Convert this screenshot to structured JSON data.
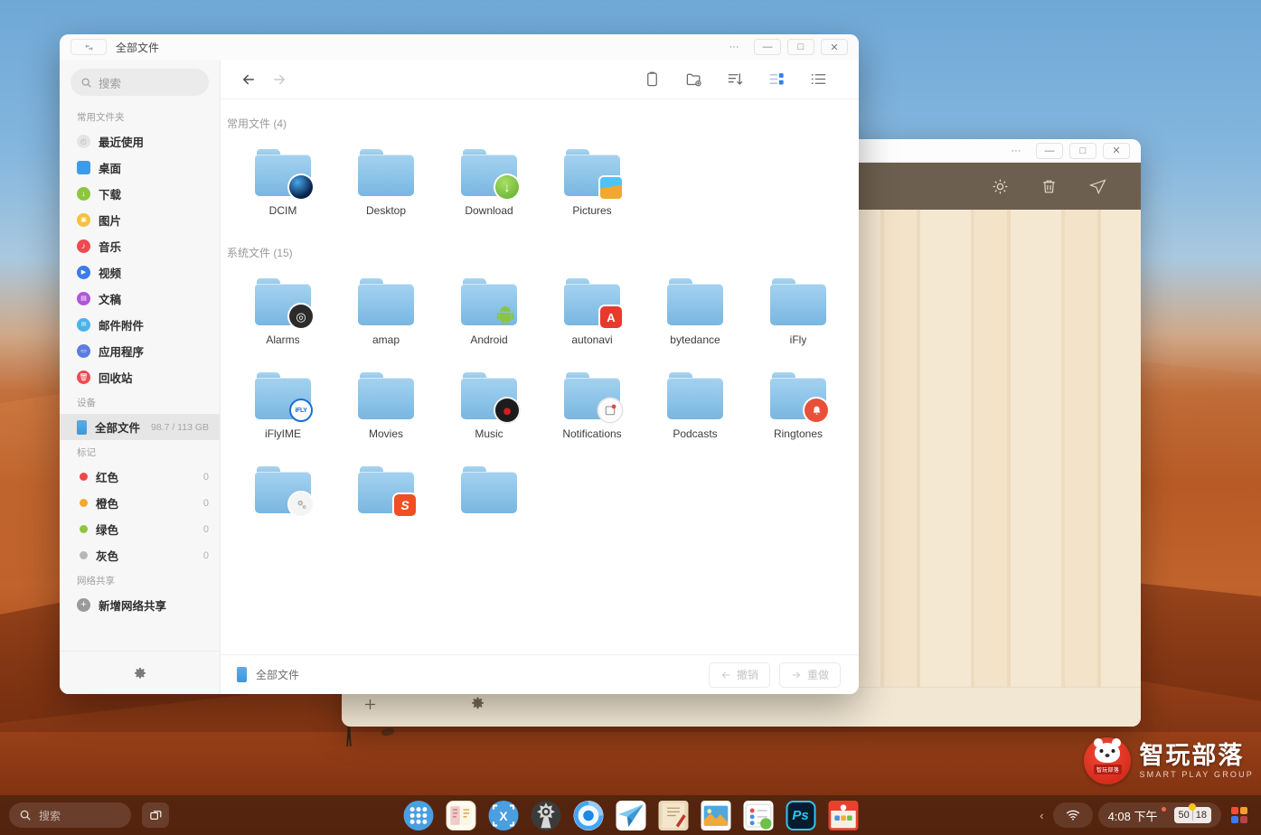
{
  "desktop": {
    "watermark": {
      "title": "智玩部落",
      "subtitle": "SMART PLAY GROUP",
      "badge_text": "智玩部落"
    }
  },
  "back_window": {
    "titlebar": {
      "more": "···",
      "minimize": "—",
      "maximize": "□",
      "close": "✕"
    },
    "toolbar_icons": [
      "brightness-icon",
      "trash-icon",
      "send-icon"
    ],
    "footer_icons": [
      "add-icon",
      "settings-icon"
    ]
  },
  "filemanager": {
    "title": "全部文件",
    "titlebar": {
      "more": "···",
      "minimize": "—",
      "maximize": "□",
      "close": "✕"
    },
    "sidebar": {
      "search_placeholder": "搜索",
      "groups": [
        {
          "title": "常用文件夹",
          "items": [
            {
              "label": "最近使用",
              "icon": "recent-icon",
              "color": "#e8e8e8",
              "meta": ""
            },
            {
              "label": "桌面",
              "icon": "desktop-icon",
              "color": "#3d9bea",
              "meta": ""
            },
            {
              "label": "下载",
              "icon": "download-icon",
              "color": "#8cc63e",
              "meta": ""
            },
            {
              "label": "图片",
              "icon": "pictures-icon",
              "color": "#f5c13d",
              "meta": ""
            },
            {
              "label": "音乐",
              "icon": "music-icon",
              "color": "#ef4a52",
              "meta": ""
            },
            {
              "label": "视频",
              "icon": "video-icon",
              "color": "#3d7bea",
              "meta": ""
            },
            {
              "label": "文稿",
              "icon": "documents-icon",
              "color": "#b056d6",
              "meta": ""
            },
            {
              "label": "邮件附件",
              "icon": "mail-icon",
              "color": "#4ab3ea",
              "meta": ""
            },
            {
              "label": "应用程序",
              "icon": "apps-icon",
              "color": "#5b7ce0",
              "meta": ""
            },
            {
              "label": "回收站",
              "icon": "trash-icon",
              "color": "#ef4a52",
              "meta": ""
            }
          ]
        },
        {
          "title": "设备",
          "items": [
            {
              "label": "全部文件",
              "icon": "drive-icon",
              "color": "#4aa3e8",
              "meta": "98.7 / 113 GB",
              "active": true
            }
          ]
        },
        {
          "title": "标记",
          "items": [
            {
              "label": "红色",
              "icon": "tag-dot-icon",
              "color": "#ec4a4a",
              "count": "0"
            },
            {
              "label": "橙色",
              "icon": "tag-dot-icon",
              "color": "#f0a92e",
              "count": "0"
            },
            {
              "label": "绿色",
              "icon": "tag-dot-icon",
              "color": "#8dc63f",
              "count": "0"
            },
            {
              "label": "灰色",
              "icon": "tag-dot-icon",
              "color": "#b8b8b8",
              "count": "0"
            }
          ]
        },
        {
          "title": "网络共享",
          "items": [
            {
              "label": "新增网络共享",
              "icon": "plus-circle-icon",
              "color": "#9a9a9a",
              "meta": ""
            }
          ]
        }
      ],
      "footer_icon": "settings-gear-icon"
    },
    "toolbar": {
      "back": "back-arrow-icon",
      "forward": "forward-arrow-icon",
      "buttons": [
        {
          "name": "clipboard-icon"
        },
        {
          "name": "new-folder-icon"
        },
        {
          "name": "sort-icon"
        },
        {
          "name": "grid-view-icon",
          "active": true
        },
        {
          "name": "list-view-icon"
        }
      ]
    },
    "sections": [
      {
        "title": "常用文件 (4)",
        "files": [
          {
            "name": "DCIM",
            "badge": "camera-badge",
            "badge_color": "#0b2a55",
            "badge_text": ""
          },
          {
            "name": "Desktop",
            "badge": "",
            "badge_color": "",
            "badge_text": ""
          },
          {
            "name": "Download",
            "badge": "download-badge",
            "badge_color": "#7ac143",
            "badge_text": "↓"
          },
          {
            "name": "Pictures",
            "badge": "image-badge",
            "badge_color": "#f0b030",
            "badge_text": ""
          }
        ]
      },
      {
        "title": "系统文件 (15)",
        "files": [
          {
            "name": "Alarms",
            "badge": "clock-badge",
            "badge_color": "#2d2d2d",
            "badge_text": "◎"
          },
          {
            "name": "amap",
            "badge": "",
            "badge_color": "",
            "badge_text": ""
          },
          {
            "name": "Android",
            "badge": "android-badge",
            "badge_color": "#8bc34a",
            "badge_text": ""
          },
          {
            "name": "autonavi",
            "badge": "autonavi-badge",
            "badge_color": "#e8392e",
            "badge_text": "A"
          },
          {
            "name": "bytedance",
            "badge": "",
            "badge_color": "",
            "badge_text": ""
          },
          {
            "name": "iFly",
            "badge": "",
            "badge_color": "",
            "badge_text": ""
          },
          {
            "name": "iFlyIME",
            "badge": "ifly-badge",
            "badge_color": "#1b6fd4",
            "badge_text": "iFLY"
          },
          {
            "name": "Movies",
            "badge": "",
            "badge_color": "",
            "badge_text": ""
          },
          {
            "name": "Music",
            "badge": "record-badge",
            "badge_color": "#1a1a1a",
            "badge_text": ""
          },
          {
            "name": "Notifications",
            "badge": "notification-badge",
            "badge_color": "#fafafa",
            "badge_text": ""
          },
          {
            "name": "Podcasts",
            "badge": "",
            "badge_color": "",
            "badge_text": ""
          },
          {
            "name": "Ringtones",
            "badge": "bell-badge",
            "badge_color": "#e8503a",
            "badge_text": ""
          },
          {
            "name": "",
            "badge": "gear-badge",
            "badge_color": "#f2f2f2",
            "badge_text": ""
          },
          {
            "name": "",
            "badge": "sogou-badge",
            "badge_color": "#f04e23",
            "badge_text": "S"
          },
          {
            "name": "",
            "badge": "",
            "badge_color": "",
            "badge_text": ""
          }
        ]
      }
    ],
    "statusbar": {
      "location": "全部文件",
      "undo_label": "撤销",
      "redo_label": "重做"
    }
  },
  "taskbar": {
    "search_placeholder": "搜索",
    "task_view_icon": "task-view-icon",
    "apps": [
      {
        "name": "app-launcher",
        "icon": "grid-dots-icon",
        "bg": "#4a9fe0",
        "fg": "#ffffff",
        "text": ""
      },
      {
        "name": "app-notes-cn",
        "icon": "notes-icon",
        "bg": "#fdfaf0",
        "fg": "#d4902a",
        "text": ""
      },
      {
        "name": "app-screenshot",
        "icon": "crop-icon",
        "bg": "#4a9fe0",
        "fg": "#ffffff",
        "text": "X"
      },
      {
        "name": "app-settings-gear",
        "icon": "gear-dark-icon",
        "bg": "#3a3a3a",
        "fg": "#dddddd",
        "text": ""
      },
      {
        "name": "app-browser",
        "icon": "browser-icon",
        "bg": "#eef6fd",
        "fg": "#2d8ce0",
        "text": ""
      },
      {
        "name": "app-telegram",
        "icon": "paper-plane-icon",
        "bg": "#ffffff",
        "fg": "#3fa0e0",
        "text": ""
      },
      {
        "name": "app-notebook",
        "icon": "notebook-icon",
        "bg": "#e6d4b4",
        "fg": "#8a6a40",
        "text": ""
      },
      {
        "name": "app-photos",
        "icon": "photos-icon",
        "bg": "#e8eef4",
        "fg": "#2f7fc0",
        "text": ""
      },
      {
        "name": "app-contacts",
        "icon": "contacts-icon",
        "bg": "#ffffff",
        "fg": "#e05050",
        "text": ""
      },
      {
        "name": "app-photoshop",
        "icon": "photoshop-icon",
        "bg": "#031c2e",
        "fg": "#31c5f0",
        "text": "Ps"
      },
      {
        "name": "app-store",
        "icon": "store-icon",
        "bg": "#e8412d",
        "fg": "#ffffff",
        "text": ""
      }
    ],
    "tray": {
      "chevron": "‹",
      "wifi_icon": "wifi-icon",
      "clock": "4:08 下午",
      "battery_percent": "50",
      "battery_secondary": "18",
      "logo_icon": "color-blocks-icon",
      "logo_colors": [
        "#f04e37",
        "#f0a030",
        "#3d7bea",
        "#b8444a"
      ]
    }
  }
}
